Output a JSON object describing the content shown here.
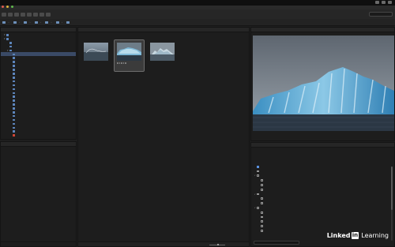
{
  "menubar": {
    "app": "",
    "items": [
      "",
      "",
      "",
      "",
      "",
      "",
      ""
    ]
  },
  "window": {
    "title": ""
  },
  "workspaces": [
    {
      "label": "",
      "active": true
    },
    {
      "label": "",
      "active": false
    },
    {
      "label": "",
      "active": false
    },
    {
      "label": "",
      "active": false
    },
    {
      "label": "",
      "active": false
    },
    {
      "label": "",
      "active": false
    }
  ],
  "path": [
    "",
    "",
    "",
    "",
    "",
    "",
    ""
  ],
  "left_tabs": [
    "",
    ""
  ],
  "tree": [
    {
      "label": "",
      "depth": 1,
      "open": true,
      "color": "blue",
      "selected": false
    },
    {
      "label": "",
      "depth": 1,
      "open": true,
      "color": "blue",
      "selected": false
    },
    {
      "label": "",
      "depth": 2,
      "open": false,
      "color": "blue",
      "selected": false
    },
    {
      "label": "",
      "depth": 2,
      "open": false,
      "color": "blue",
      "selected": false
    },
    {
      "label": "",
      "depth": 2,
      "open": true,
      "color": "blue",
      "selected": false
    },
    {
      "label": "",
      "depth": 3,
      "open": false,
      "color": "blue",
      "selected": true
    },
    {
      "label": "",
      "depth": 3,
      "open": false,
      "color": "blue",
      "selected": false
    },
    {
      "label": "",
      "depth": 3,
      "open": false,
      "color": "blue",
      "selected": false
    },
    {
      "label": "",
      "depth": 3,
      "open": false,
      "color": "blue",
      "selected": false
    },
    {
      "label": "",
      "depth": 3,
      "open": false,
      "color": "blue",
      "selected": false
    },
    {
      "label": "",
      "depth": 3,
      "open": false,
      "color": "blue",
      "selected": false
    },
    {
      "label": "",
      "depth": 3,
      "open": false,
      "color": "blue",
      "selected": false
    },
    {
      "label": "",
      "depth": 3,
      "open": false,
      "color": "blue",
      "selected": false
    },
    {
      "label": "",
      "depth": 3,
      "open": false,
      "color": "blue",
      "selected": false
    },
    {
      "label": "",
      "depth": 3,
      "open": false,
      "color": "blue",
      "selected": false
    },
    {
      "label": "",
      "depth": 3,
      "open": false,
      "color": "blue",
      "selected": false
    },
    {
      "label": "",
      "depth": 3,
      "open": false,
      "color": "blue",
      "selected": false
    },
    {
      "label": "",
      "depth": 3,
      "open": false,
      "color": "blue",
      "selected": false
    },
    {
      "label": "",
      "depth": 3,
      "open": false,
      "color": "blue",
      "selected": false
    },
    {
      "label": "",
      "depth": 3,
      "open": false,
      "color": "blue",
      "selected": false
    },
    {
      "label": "",
      "depth": 3,
      "open": false,
      "color": "blue",
      "selected": false
    },
    {
      "label": "",
      "depth": 3,
      "open": false,
      "color": "blue",
      "selected": false
    },
    {
      "label": "",
      "depth": 3,
      "open": false,
      "color": "blue",
      "selected": false
    },
    {
      "label": "",
      "depth": 3,
      "open": false,
      "color": "blue",
      "selected": false
    },
    {
      "label": "",
      "depth": 3,
      "open": false,
      "color": "blue",
      "selected": false
    },
    {
      "label": "",
      "depth": 3,
      "open": false,
      "color": "blue",
      "selected": false
    },
    {
      "label": "",
      "depth": 3,
      "open": false,
      "color": "red",
      "selected": false
    }
  ],
  "collections": {
    "tabs": [
      "",
      "",
      ""
    ],
    "empty_text": ""
  },
  "content": {
    "tab": "",
    "files": [
      {
        "name": "",
        "selected": false
      },
      {
        "name": "",
        "selected": true
      },
      {
        "name": "",
        "selected": false
      }
    ],
    "status": ""
  },
  "preview": {
    "tabs": [
      "",
      ""
    ],
    "caption": ""
  },
  "metadata": {
    "tabs": [
      "",
      "",
      ""
    ],
    "header": "",
    "keywords": [
      {
        "label": "",
        "checked": true,
        "level": 0,
        "toggle": ""
      },
      {
        "label": "",
        "checked": false,
        "level": 0,
        "toggle": ""
      },
      {
        "label": "",
        "checked": false,
        "level": 0,
        "toggle": "v"
      },
      {
        "label": "",
        "checked": false,
        "level": 1,
        "toggle": ""
      },
      {
        "label": "",
        "checked": false,
        "level": 1,
        "toggle": ""
      },
      {
        "label": "",
        "checked": false,
        "level": 1,
        "toggle": ""
      },
      {
        "label": "",
        "checked": false,
        "level": 0,
        "toggle": "v"
      },
      {
        "label": "",
        "checked": false,
        "level": 1,
        "toggle": ""
      },
      {
        "label": "",
        "checked": false,
        "level": 1,
        "toggle": ""
      },
      {
        "label": "",
        "checked": false,
        "level": 0,
        "toggle": "v"
      },
      {
        "label": "",
        "checked": false,
        "level": 1,
        "toggle": ""
      },
      {
        "label": "",
        "checked": false,
        "level": 1,
        "toggle": ""
      },
      {
        "label": "",
        "checked": false,
        "level": 1,
        "toggle": ""
      },
      {
        "label": "",
        "checked": false,
        "level": 1,
        "toggle": ""
      },
      {
        "label": "",
        "checked": false,
        "level": 1,
        "toggle": ""
      }
    ]
  },
  "watermark": {
    "brand_left": "Linked",
    "brand_box": "in",
    "brand_right": "Learning"
  },
  "colors": {
    "accent": "#2d8ceb",
    "selection": "#3a4a66",
    "folder": "#5d86bd",
    "red_label": "#cf4636"
  }
}
